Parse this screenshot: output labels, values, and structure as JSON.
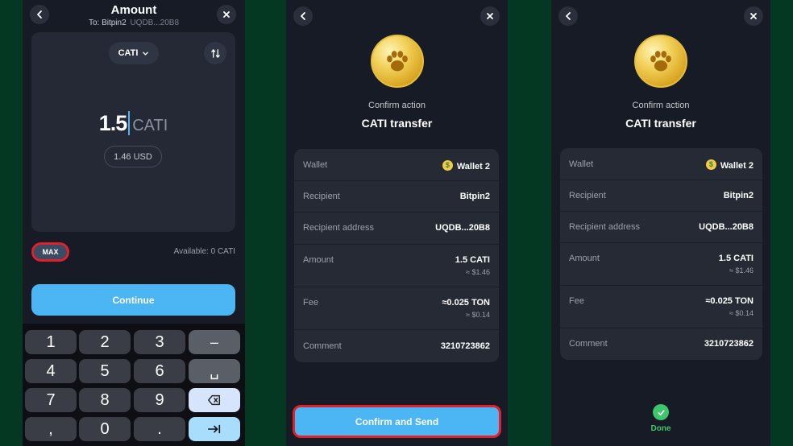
{
  "amount_screen": {
    "title": "Amount",
    "to_label": "To: Bitpin2",
    "to_address": "UQDB...20B8",
    "token": "CATI",
    "amount": "1.5",
    "amount_currency": "CATI",
    "usd_value": "1.46 USD",
    "max_label": "MAX",
    "available": "Available: 0 CATI",
    "continue_label": "Continue",
    "keypad": [
      "1",
      "2",
      "3",
      "–",
      "4",
      "5",
      "6",
      "␣",
      "7",
      "8",
      "9",
      "⌫",
      ",",
      "0",
      ".",
      "⇥"
    ]
  },
  "confirm_screen": {
    "confirm_label": "Confirm action",
    "title": "CATI transfer",
    "wallet_label": "Wallet",
    "wallet_value": "Wallet 2",
    "recipient_label": "Recipient",
    "recipient_value": "Bitpin2",
    "address_label": "Recipient address",
    "address_value": "UQDB...20B8",
    "amount_label": "Amount",
    "amount_value": "1.5 CATI",
    "amount_usd": "≈ $1.46",
    "fee_label": "Fee",
    "fee_value": "≈0.025 TON",
    "fee_usd": "≈ $0.14",
    "comment_label": "Comment",
    "comment_value": "3210723862",
    "confirm_send_label": "Confirm and Send"
  },
  "done_screen": {
    "done_label": "Done"
  },
  "colors": {
    "background": "#053822",
    "panel": "#171b25",
    "accent": "#4cb6f5",
    "highlight": "#e0202a",
    "success": "#3fc56b"
  },
  "icons": [
    "back-icon",
    "close-icon",
    "chevron-down-icon",
    "swap-icon",
    "paw-coin-icon",
    "money-face-icon",
    "backspace-icon",
    "next-icon",
    "check-icon"
  ]
}
